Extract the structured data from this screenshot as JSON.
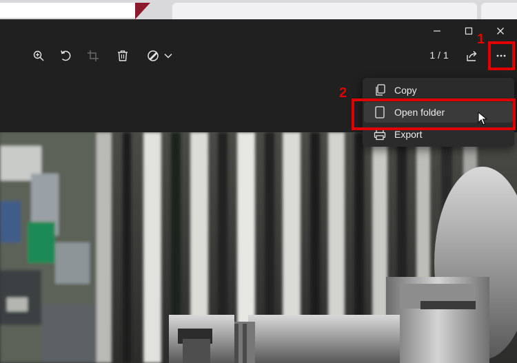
{
  "app": {
    "counter": "1 / 1"
  },
  "menu": {
    "items": [
      {
        "label": "Copy",
        "icon": "copy-icon"
      },
      {
        "label": "Open folder",
        "icon": "folder-icon"
      },
      {
        "label": "Export",
        "icon": "print-icon"
      }
    ]
  },
  "annotations": {
    "step1": "1",
    "step2": "2",
    "highlight_color": "#e10000"
  },
  "toolbar": {
    "icons": [
      "zoom-in-icon",
      "rotate-icon",
      "crop-icon",
      "delete-icon",
      "edit-icon",
      "chevron-down-icon",
      "share-icon",
      "more-icon"
    ]
  },
  "window_controls": [
    "minimize-icon",
    "maximize-icon",
    "close-icon"
  ]
}
